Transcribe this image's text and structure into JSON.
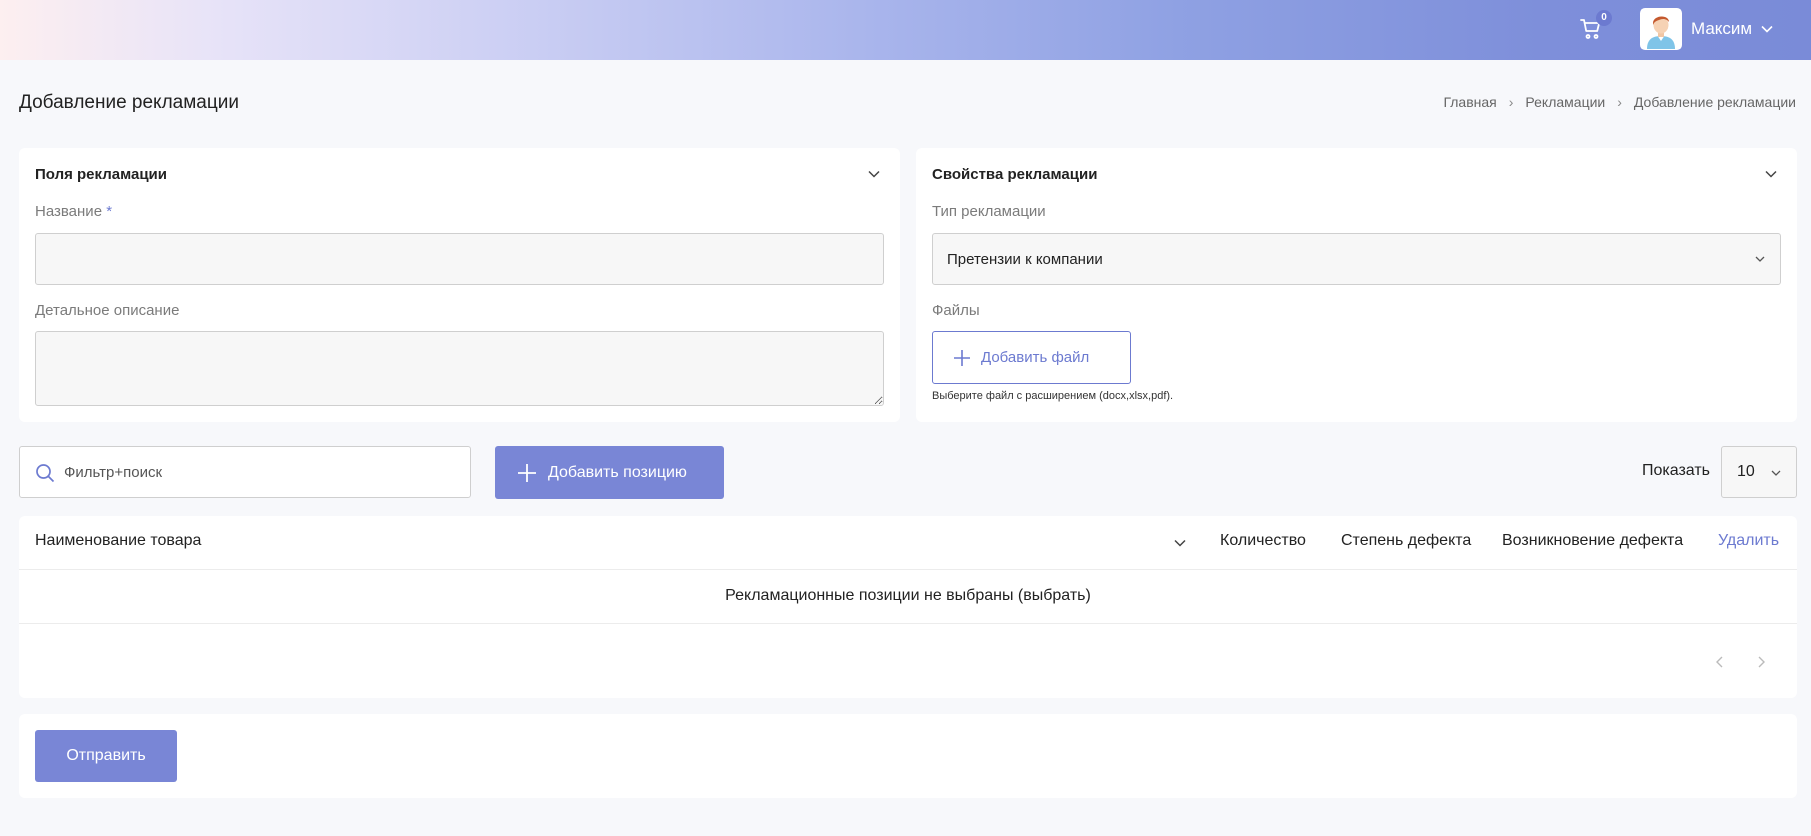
{
  "header": {
    "cart_count": "0",
    "user_name": "Максим"
  },
  "page": {
    "title": "Добавление рекламации",
    "breadcrumb": [
      "Главная",
      "Рекламации",
      "Добавление рекламации"
    ]
  },
  "fields_card": {
    "title": "Поля рекламации",
    "name_label": "Название",
    "name_required_mark": "*",
    "name_value": "",
    "description_label": "Детальное описание",
    "description_value": ""
  },
  "props_card": {
    "title": "Свойства рекламации",
    "type_label": "Тип рекламации",
    "type_value": "Претензии к компании",
    "files_label": "Файлы",
    "add_file_label": "Добавить файл",
    "file_hint": "Выберите файл с расширением (docx,xlsx,pdf)."
  },
  "toolbar": {
    "search_placeholder": "Фильтр+поиск",
    "add_position_label": "Добавить позицию",
    "show_label": "Показать",
    "show_value": "10"
  },
  "table": {
    "columns": [
      "Наименование товара",
      "Количество",
      "Степень дефекта",
      "Возникновение дефекта",
      "Удалить"
    ],
    "empty_message": "Рекламационные позиции не выбраны (выбрать)"
  },
  "submit": {
    "label": "Отправить"
  },
  "colors": {
    "accent": "#7986d6",
    "accent_text": "#6c7ad0"
  }
}
